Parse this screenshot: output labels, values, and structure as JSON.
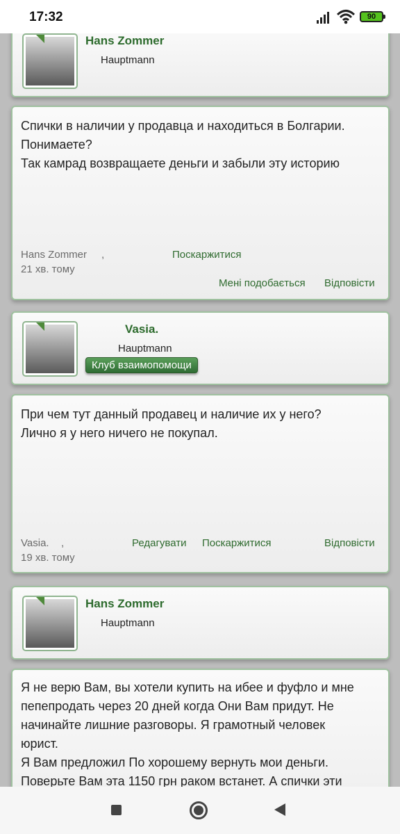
{
  "status": {
    "time": "17:32",
    "battery": "90"
  },
  "profiles": [
    {
      "name": "Hans Zommer",
      "rank": "Hauptmann"
    },
    {
      "name": "Vasia.",
      "rank": "Hauptmann",
      "club": "Клуб взаимопомощи"
    },
    {
      "name": "Hans Zommer",
      "rank": "Hauptmann"
    }
  ],
  "messages": [
    {
      "lines": [
        "Спички в наличии у продавца и находиться в Болгарии.",
        "Понимаете?",
        "Так камрад возвращаете деньги и забыли эту историю"
      ],
      "author": "Hans Zommer",
      "comma": ",",
      "time": "21 хв. тому",
      "report": "Поскаржитися",
      "like": "Мені подобається",
      "reply": "Відповісти"
    },
    {
      "lines": [
        "При чем тут данный продавец и наличие их у него?",
        "Лично я у него ничего не покупал."
      ],
      "author": "Vasia.",
      "comma": ",",
      "time": "19 хв. тому",
      "edit": "Редагувати",
      "report": "Поскаржитися",
      "reply": "Відповісти"
    },
    {
      "lines": [
        "Я не верю Вам, вы хотели купить на ибее и фуфло и мне",
        "пепепродать через 20 дней когда Они Вам придут. Не",
        "начинайте лишние разговоры. Я грамотный человек",
        "юрист.",
        "Я Вам предложил По хорошему вернуть мои деньги.",
        "Поверьте Вам эта 1150 грн раком встанет. А спички эти"
      ]
    }
  ],
  "colors": {
    "accent": "#2f6b2f",
    "button": "#3d7d3d",
    "card_border": "#9fc19f"
  },
  "icons": [
    "signal-icon",
    "wifi-icon",
    "battery-icon",
    "square-nav-icon",
    "home-circle-icon",
    "back-triangle-icon"
  ]
}
